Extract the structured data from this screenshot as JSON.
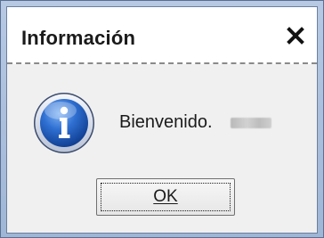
{
  "dialog": {
    "title": "Información",
    "close_icon": "close-icon",
    "info_icon": "information-icon",
    "message": "Bienvenido.",
    "ok_label": "OK"
  },
  "colors": {
    "frame": "#a8bcd8",
    "content_bg": "#f0f0f0",
    "icon_blue": "#1e56b8"
  }
}
